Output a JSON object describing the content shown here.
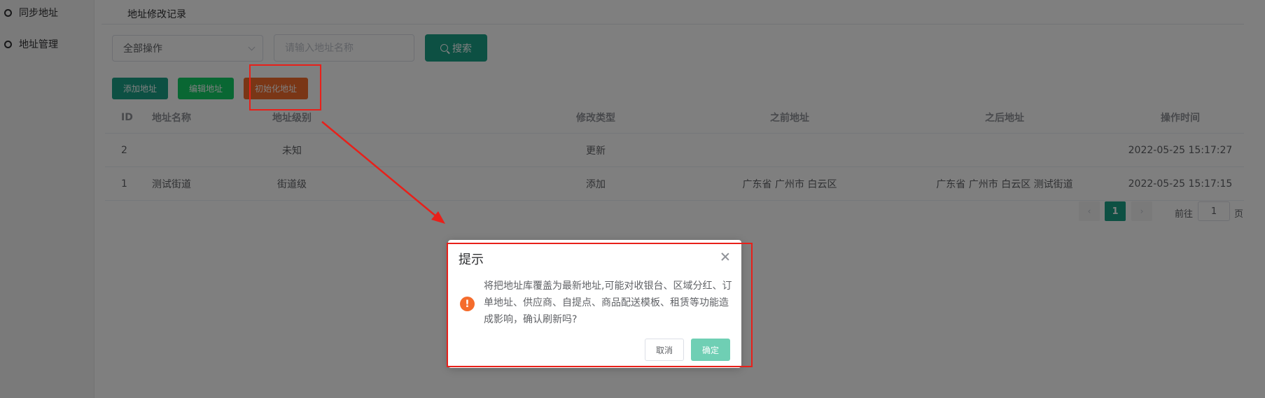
{
  "sidebar": {
    "items": [
      {
        "label": "同步地址"
      },
      {
        "label": "地址管理"
      }
    ]
  },
  "page": {
    "title": "地址修改记录"
  },
  "filters": {
    "operation_select": "全部操作",
    "search_placeholder": "请输入地址名称",
    "search_button": "搜索"
  },
  "toolbar": {
    "add_label": "添加地址",
    "edit_label": "编辑地址",
    "init_label": "初始化地址"
  },
  "table": {
    "headers": {
      "id": "ID",
      "name": "地址名称",
      "level": "地址级别",
      "type": "修改类型",
      "before": "之前地址",
      "after": "之后地址",
      "time": "操作时间"
    },
    "rows": [
      {
        "id": "2",
        "name": "",
        "level": "未知",
        "type": "更新",
        "before": "",
        "after": "",
        "time": "2022-05-25 15:17:27"
      },
      {
        "id": "1",
        "name": "测试街道",
        "level": "街道级",
        "type": "添加",
        "before": "广东省 广州市 白云区",
        "after": "广东省 广州市 白云区 测试街道",
        "time": "2022-05-25 15:17:15"
      }
    ]
  },
  "pagination": {
    "current": "1",
    "goto_label": "前往",
    "goto_value": "1",
    "page_suffix": "页"
  },
  "dialog": {
    "title": "提示",
    "icon": "!",
    "message": "将把地址库覆盖为最新地址,可能对收银台、区域分红、订单地址、供应商、自提点、商品配送模板、租赁等功能造成影响，确认刷新吗?",
    "cancel": "取消",
    "confirm": "确定"
  },
  "colors": {
    "primary": "#1aa087",
    "success": "#13ce66",
    "warning": "#f56c2c",
    "annotation": "#e8201a"
  }
}
